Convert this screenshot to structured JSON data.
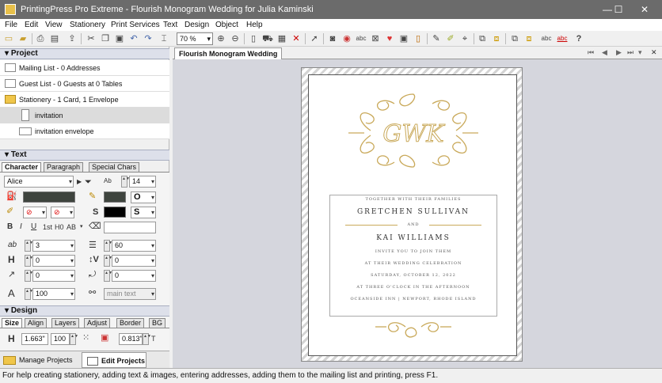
{
  "window": {
    "title": "PrintingPress Pro Extreme - Flourish Monogram Wedding for Julia Kaminski",
    "minimize": "—",
    "maximize": "☐",
    "close": "✕"
  },
  "menu": [
    "File",
    "Edit",
    "View",
    "Stationery",
    "Print Services",
    "Text",
    "Design",
    "Object",
    "Help"
  ],
  "toolbar": {
    "zoom_value": "70 %",
    "icons": [
      "new-icon",
      "open-icon",
      "save-icon",
      "print-icon",
      "print-preview-icon",
      "publish-icon",
      "cut-icon",
      "copy-icon",
      "paste-icon",
      "undo-icon",
      "redo-icon",
      "zoom-in-icon",
      "zoom-out-icon",
      "page-icon",
      "delivery-icon",
      "grid-icon",
      "delete-icon",
      "pointer-icon",
      "camera-icon",
      "label-icon",
      "abc-icon",
      "heart-icon",
      "frame-icon",
      "border-icon",
      "pen-icon",
      "eyedropper-icon",
      "transform-icon",
      "spellcheck-icon",
      "help-icon"
    ]
  },
  "project": {
    "header": "Project",
    "items": [
      {
        "label": "Mailing List - 0 Addresses",
        "icon": "mailing-list-icon"
      },
      {
        "label": "Guest List - 0 Guests at 0 Tables",
        "icon": "guest-list-icon"
      },
      {
        "label": "Stationery - 1 Card, 1 Envelope",
        "icon": "folder-icon"
      },
      {
        "label": "invitation",
        "icon": "page-icon"
      },
      {
        "label": "invitation envelope",
        "icon": "envelope-icon"
      }
    ]
  },
  "text_panel": {
    "header": "Text",
    "tabs": [
      "Character",
      "Paragraph",
      "Special Chars"
    ],
    "font": "Alice",
    "size": "14",
    "style_buttons": [
      "B",
      "I",
      "U",
      "1st",
      "H0",
      "AB"
    ],
    "kerning": "3",
    "line_spacing": "60",
    "height": "0",
    "width": "0",
    "baseline": "0",
    "rotation": "0",
    "scale": "100",
    "style_name": "main text",
    "colors": {
      "fill": "#3e443e",
      "outline": "#3e443e",
      "shadow": "#000000"
    }
  },
  "design_panel": {
    "header": "Design",
    "tabs": [
      "Size",
      "Align",
      "Layers",
      "Adjust",
      "Border",
      "BG"
    ],
    "height": "1.663\"",
    "percent": "100",
    "offset": "0.813\""
  },
  "bottom_tabs": [
    "Manage Projects",
    "Edit Projects"
  ],
  "document": {
    "tab": "Flourish Monogram Wedding",
    "monogram": "GWK",
    "lines": {
      "together": "TOGETHER WITH THEIR FAMILIES",
      "name1": "GRETCHEN SULLIVAN",
      "and": "AND",
      "name2": "KAI WILLIAMS",
      "invite": "INVITE YOU TO JOIN THEM",
      "celebration": "AT THEIR WEDDING CELEBRATION",
      "date": "SATURDAY, OCTOBER 12, 2022",
      "time": "AT THREE O'CLOCK IN THE AFTERNOON",
      "venue": "OCEANSIDE INN | NEWPORT, RHODE ISLAND"
    },
    "gold": "#c9a95a"
  },
  "status": "For help creating stationery, adding text & images, entering addresses, adding them to the mailing list and printing, press F1."
}
